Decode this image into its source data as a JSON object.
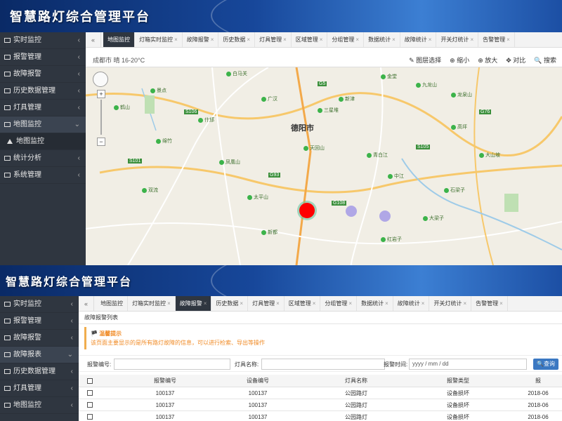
{
  "app_title": "智慧路灯综合管理平台",
  "sidebar_top": [
    {
      "label": "实时监控",
      "active": false
    },
    {
      "label": "报警管理",
      "active": false
    },
    {
      "label": "故障报警",
      "active": false
    },
    {
      "label": "历史数据管理",
      "active": false
    },
    {
      "label": "灯具管理",
      "active": false
    },
    {
      "label": "地图监控",
      "active": true
    },
    {
      "label": "地图监控",
      "sub": true
    },
    {
      "label": "统计分析",
      "active": false
    },
    {
      "label": "系统管理",
      "active": false
    }
  ],
  "tabs_top": [
    "地图监控",
    "灯箱实时监控",
    "故障报警",
    "历史数据",
    "灯具管理",
    "区域管理",
    "分组管理",
    "数据统计",
    "故障统计",
    "开关灯统计",
    "告警管理"
  ],
  "map_header": {
    "city": "成都市 晴 16-20°C",
    "tools": [
      "✎ 图层选择",
      "⊕ 缩小",
      "⊕ 放大",
      "✥ 对比",
      "🔍 搜索"
    ]
  },
  "map_labels": {
    "city_center": "德阳市",
    "pois": [
      "白马关",
      "景点",
      "鹤山",
      "广汉",
      "新津",
      "金堂",
      "九龙山",
      "龙泉山",
      "青白江",
      "三星堆",
      "什邡",
      "绵竹",
      "中江",
      "天回山",
      "太平山",
      "凤凰山",
      "双流",
      "高坪",
      "大山坡",
      "石梁子",
      "大梁子",
      "红岩子",
      "新都"
    ],
    "roads": [
      "G5",
      "G93",
      "S106",
      "S105",
      "G108",
      "G76",
      "S101"
    ]
  },
  "sidebar_bottom": [
    {
      "label": "实时监控"
    },
    {
      "label": "报警管理"
    },
    {
      "label": "故障报警"
    },
    {
      "label": "故障报表",
      "active": true
    },
    {
      "label": "历史数据管理"
    },
    {
      "label": "灯具管理"
    },
    {
      "label": "地图监控"
    }
  ],
  "tabs_bottom": [
    "地图监控",
    "灯箱实时监控",
    "故障报警",
    "历史数据",
    "灯具管理",
    "区域管理",
    "分组管理",
    "数据统计",
    "故障统计",
    "开关灯统计",
    "告警管理"
  ],
  "fault_list": {
    "section_title": "故障报警列表",
    "notice_title": "温馨提示",
    "notice_text": "该页面主要显示的是所有路灯故障的信息，可以进行检索、导出等操作",
    "form": {
      "code_label": "报警编号:",
      "name_label": "灯具名称:",
      "date_label": "报警时间:",
      "date_placeholder": "yyyy / mm / dd",
      "query_label": "查询"
    },
    "columns": [
      "报警编号",
      "设备编号",
      "灯具名称",
      "报警类型",
      "报"
    ],
    "rows": [
      [
        "100137",
        "100137",
        "公园路灯",
        "设备损坏",
        "2018-06"
      ],
      [
        "100137",
        "100137",
        "公园路灯",
        "设备损坏",
        "2018-06"
      ],
      [
        "100137",
        "100137",
        "公园路灯",
        "设备损坏",
        "2018-06"
      ]
    ]
  },
  "colors": {
    "sidebar": "#2f3640",
    "banner": "#17479a",
    "accent": "#3b78c2",
    "alarm": "#ff0000"
  }
}
